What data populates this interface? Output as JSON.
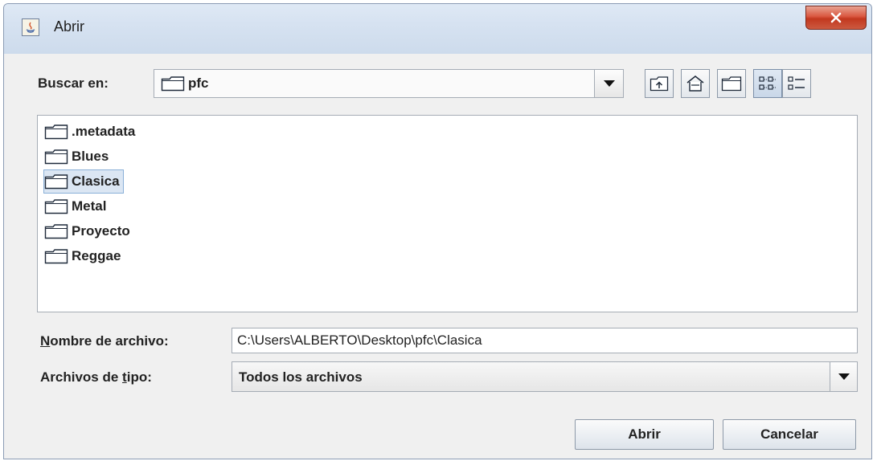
{
  "window": {
    "title": "Abrir"
  },
  "toolbar": {
    "look_in_label": "Buscar en:",
    "look_in_value": "pfc",
    "buttons": [
      "up-one-level-icon",
      "home-icon",
      "new-folder-icon",
      "list-view-icon",
      "details-view-icon"
    ]
  },
  "files": [
    {
      "name": ".metadata",
      "icon": "folder-icon",
      "selected": false
    },
    {
      "name": "Blues",
      "icon": "folder-icon",
      "selected": false
    },
    {
      "name": "Clasica",
      "icon": "folder-icon",
      "selected": true
    },
    {
      "name": "Metal",
      "icon": "folder-icon",
      "selected": false
    },
    {
      "name": "Proyecto",
      "icon": "folder-icon",
      "selected": false
    },
    {
      "name": "Reggae",
      "icon": "folder-icon",
      "selected": false
    }
  ],
  "file_name": {
    "label_mnemonic": "N",
    "label_rest": "ombre de archivo:",
    "value": "C:\\Users\\ALBERTO\\Desktop\\pfc\\Clasica"
  },
  "file_type": {
    "label_before": "Archivos de ",
    "label_mnemonic": "t",
    "label_after": "ipo:",
    "value": "Todos los archivos"
  },
  "actions": {
    "open_label": "Abrir",
    "cancel_label": "Cancelar"
  },
  "colors": {
    "selection": "#dbe6f3",
    "close_button": "#c2381f",
    "title_bar": "#d6e2f1"
  }
}
